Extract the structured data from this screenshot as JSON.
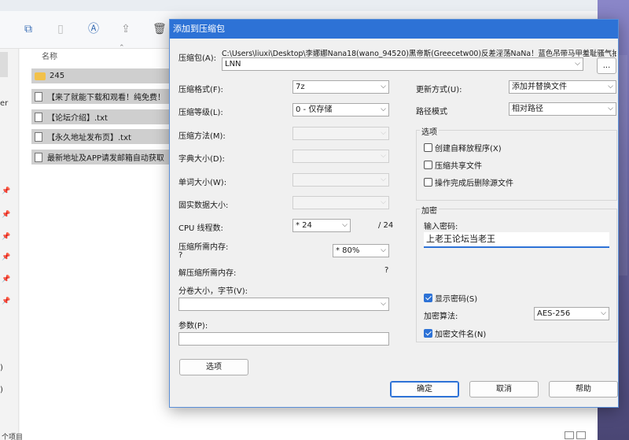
{
  "explorer": {
    "column_name": "名称",
    "files": [
      {
        "name": "245",
        "kind": "folder"
      },
      {
        "name": "【来了就能下载和观看！纯免费！",
        "kind": "txt"
      },
      {
        "name": "【论坛介绍】.txt",
        "kind": "txt"
      },
      {
        "name": "【永久地址发布页】.txt",
        "kind": "txt"
      },
      {
        "name": "最新地址及APP请发邮箱自动获取",
        "kind": "txt"
      }
    ],
    "left_text_er": "er",
    "left_text_b1": ")",
    "left_text_b2": ")",
    "status_fragment": "个项目"
  },
  "dialog": {
    "title": "添加到压缩包",
    "archive_label": "压缩包(A):",
    "archive_path": "C:\\Users\\liuxi\\Desktop\\李娜娜Nana18(wano_94520)黑帝斯(Greecetw00)反差淫荡NaNa！蓝色吊带马甲羞耻骚气抽",
    "archive_name": "LNN",
    "browse_label": "...",
    "format_label": "压缩格式(F):",
    "format_value": "7z",
    "level_label": "压缩等级(L):",
    "level_value": "0 - 仅存储",
    "method_label": "压缩方法(M):",
    "dict_label": "字典大小(D):",
    "word_label": "单词大小(W):",
    "solid_label": "固实数据大小:",
    "cpu_label": "CPU 线程数:",
    "cpu_value": "* 24",
    "cpu_max": "/ 24",
    "mem_label": "压缩所需内存:",
    "mem_value": "?",
    "mem_pct": "* 80%",
    "decomp_label": "解压缩所需内存:",
    "decomp_value": "?",
    "split_label": "分卷大小，字节(V):",
    "params_label": "参数(P):",
    "options_button": "选项",
    "update_label": "更新方式(U):",
    "update_value": "添加并替换文件",
    "pathmode_label": "路径模式",
    "pathmode_value": "相对路径",
    "options_group": "选项",
    "opt_sfx": "创建自释放程序(X)",
    "opt_shared": "压缩共享文件",
    "opt_delete": "操作完成后删除源文件",
    "encrypt_group": "加密",
    "password_label": "输入密码:",
    "password_value": "上老王论坛当老王",
    "show_password": "显示密码(S)",
    "enc_method_label": "加密算法:",
    "enc_method_value": "AES-256",
    "encrypt_names": "加密文件名(N)",
    "ok": "确定",
    "cancel": "取消",
    "help": "帮助"
  }
}
